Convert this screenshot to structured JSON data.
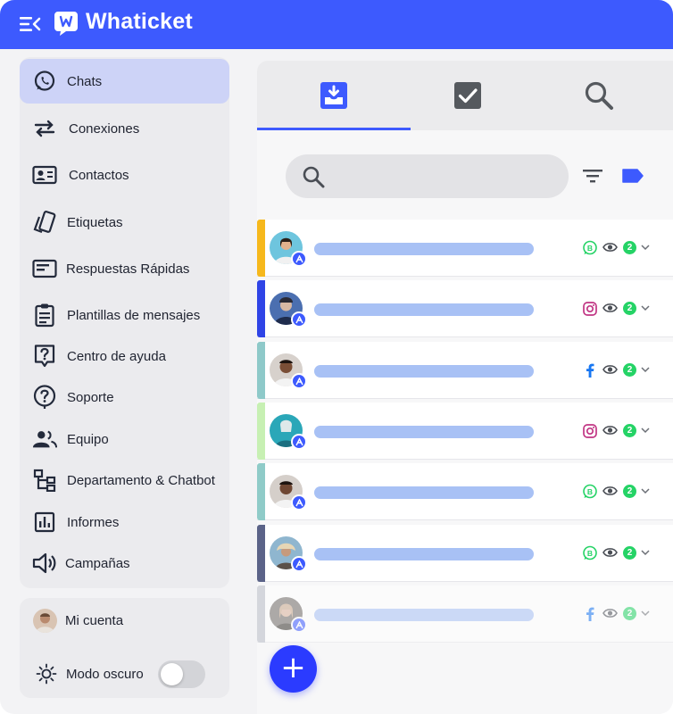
{
  "app": {
    "brand": "Whaticket",
    "brand_color": "#3d5afe"
  },
  "sidebar": {
    "items": [
      {
        "label": "Chats",
        "icon": "whatsapp-icon",
        "active": true
      },
      {
        "label": "Conexiones",
        "icon": "swap-arrows-icon"
      },
      {
        "label": "Contactos",
        "icon": "contact-card-icon"
      },
      {
        "label": "Etiquetas",
        "icon": "labels-icon"
      },
      {
        "label": "Respuestas Rápidas",
        "icon": "quick-reply-icon"
      },
      {
        "label": "Plantillas de mensajes",
        "icon": "clipboard-icon"
      },
      {
        "label": "Centro de ayuda",
        "icon": "help-center-icon"
      },
      {
        "label": "Soporte",
        "icon": "support-icon"
      },
      {
        "label": "Equipo",
        "icon": "team-icon"
      },
      {
        "label": "Departamento & Chatbot",
        "icon": "org-chart-icon"
      },
      {
        "label": "Informes",
        "icon": "bar-chart-icon"
      },
      {
        "label": "Campañas",
        "icon": "megaphone-icon"
      }
    ]
  },
  "account": {
    "label": "Mi cuenta",
    "dark_mode_label": "Modo oscuro",
    "dark_mode_on": false
  },
  "tabs": [
    {
      "icon": "inbox-icon",
      "active": true
    },
    {
      "icon": "resolved-check-icon",
      "active": false
    },
    {
      "icon": "search-tab-icon",
      "active": false
    }
  ],
  "search": {
    "placeholder": "",
    "value": ""
  },
  "chats": [
    {
      "stripe": "#f6b81c",
      "channel": "whatsapp-business-icon",
      "count": "2",
      "avatar": "#6ec5de"
    },
    {
      "stripe": "#2f44e6",
      "channel": "instagram-icon",
      "count": "2",
      "avatar": "#4b6fb0"
    },
    {
      "stripe": "#8ec9c9",
      "channel": "facebook-icon",
      "count": "2",
      "avatar": "#9b7560"
    },
    {
      "stripe": "#c7f0b3",
      "channel": "instagram-icon",
      "count": "2",
      "avatar": "#2aa7b8"
    },
    {
      "stripe": "#8fcbc8",
      "channel": "whatsapp-business-icon",
      "count": "2",
      "avatar": "#8c6a55"
    },
    {
      "stripe": "#5b6388",
      "channel": "whatsapp-business-icon",
      "count": "2",
      "avatar": "#8fb6cf"
    },
    {
      "stripe": "#b9bcc6",
      "channel": "facebook-icon",
      "count": "2",
      "avatar": "#6f6a66"
    }
  ],
  "colors": {
    "whatsapp": "#25d366",
    "instagram": "#c13584",
    "facebook": "#1877f2",
    "fab": "#2b3bff"
  },
  "fab": {
    "label": "+"
  }
}
